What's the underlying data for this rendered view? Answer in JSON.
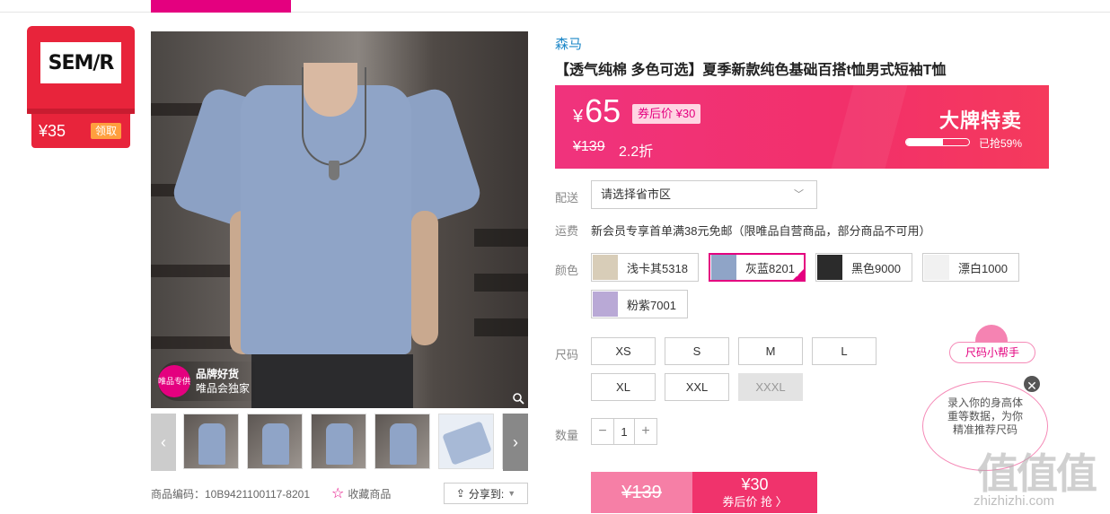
{
  "brand_badge": {
    "logo": "SEM/R",
    "coupon_price": "¥35",
    "claim_label": "领取"
  },
  "main_image": {
    "badge_circle": "唯品专供",
    "badge_title": "品牌好货",
    "badge_subtitle": "唯品会独家"
  },
  "product_code": "商品编码：10B9421100117-8201",
  "favorite_label": "收藏商品",
  "share_label": "分享到:",
  "brand": "森马",
  "title": "【透气纯棉 多色可选】夏季新款纯色基础百搭t恤男式短袖T恤",
  "price": {
    "currency": "¥",
    "current": "65",
    "coupon": "券后价 ¥30",
    "original": "¥139",
    "discount": "2.2折",
    "promo": "大牌特卖",
    "sold_fraction": 0.59,
    "sold_text": "已抢59%"
  },
  "delivery": {
    "label": "配送",
    "placeholder": "请选择省市区"
  },
  "shipping": {
    "label": "运费",
    "text": "新会员专享首单满38元免邮（限唯品自营商品，部分商品不可用）"
  },
  "colors": {
    "label": "颜色",
    "options": [
      {
        "name": "浅卡其5318",
        "swatch": "#d8cdb8"
      },
      {
        "name": "灰蓝8201",
        "swatch": "#8fa4c7",
        "selected": true
      },
      {
        "name": "黑色9000",
        "swatch": "#2b2b2b"
      },
      {
        "name": "漂白1000",
        "swatch": "#f1f1f1"
      },
      {
        "name": "粉紫7001",
        "swatch": "#b9a9d6"
      }
    ]
  },
  "sizes": {
    "label": "尺码",
    "options": [
      {
        "name": "XS"
      },
      {
        "name": "S"
      },
      {
        "name": "M"
      },
      {
        "name": "L"
      },
      {
        "name": "XL"
      },
      {
        "name": "XXL"
      },
      {
        "name": "XXXL",
        "disabled": true
      }
    ]
  },
  "quantity": {
    "label": "数量",
    "value": "1",
    "minus": "−",
    "plus": "+"
  },
  "buy": {
    "original": "¥139",
    "price": "¥30",
    "cta": "券后价 抢 〉"
  },
  "size_helper": {
    "title": "尺码小帮手",
    "line1": "录入你的身高体",
    "line2": "重等数据，为你",
    "line3": "精准推荐尺码",
    "close": "✕"
  },
  "watermark": {
    "logo": "值值值",
    "url": "zhizhizhi.com"
  },
  "colors_theme": {
    "accent": "#e4007f",
    "banner": "#f0337d",
    "link": "#1e88c8"
  }
}
